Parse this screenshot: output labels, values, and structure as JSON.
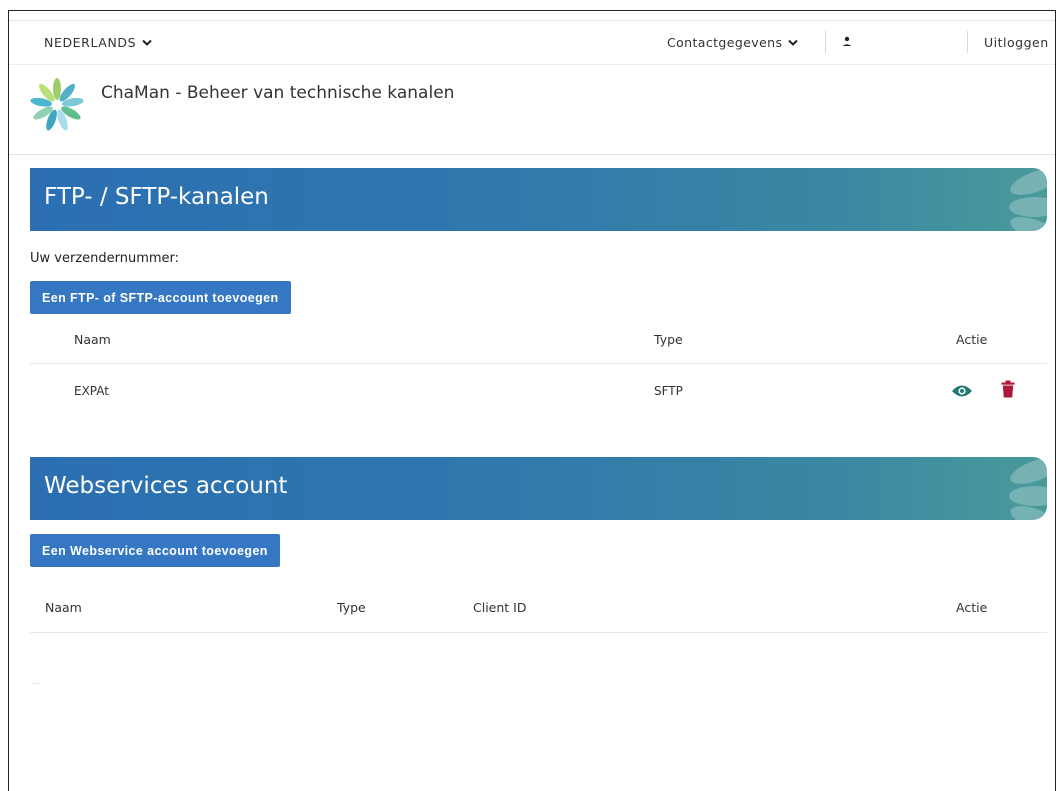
{
  "topbar": {
    "language": "NEDERLANDS",
    "contact": "Contactgegevens",
    "logout": "Uitloggen"
  },
  "app": {
    "title": "ChaMan - Beheer van technische kanalen"
  },
  "ftp_section": {
    "title": "FTP- / SFTP-kanalen",
    "sender_label": "Uw verzendernummer:",
    "add_button": "Een FTP- of SFTP-account toevoegen",
    "columns": {
      "name": "Naam",
      "type": "Type",
      "action": "Actie"
    },
    "rows": [
      {
        "name": "EXPAt",
        "type": "SFTP"
      }
    ]
  },
  "ws_section": {
    "title": "Webservices account",
    "add_button": "Een Webservice account toevoegen",
    "columns": {
      "name": "Naam",
      "type": "Type",
      "client_id": "Client ID",
      "action": "Actie"
    }
  },
  "colors": {
    "banner": "#2f78ad",
    "button": "#3577c2",
    "eye_icon": "#1f7a70",
    "trash_icon": "#b0193a"
  },
  "icons": {
    "language_chevron": "chevron-down-icon",
    "contact_chevron": "chevron-down-icon",
    "user": "user-icon",
    "view": "eye-icon",
    "delete": "trash-icon",
    "logo": "flower-logo-icon"
  }
}
